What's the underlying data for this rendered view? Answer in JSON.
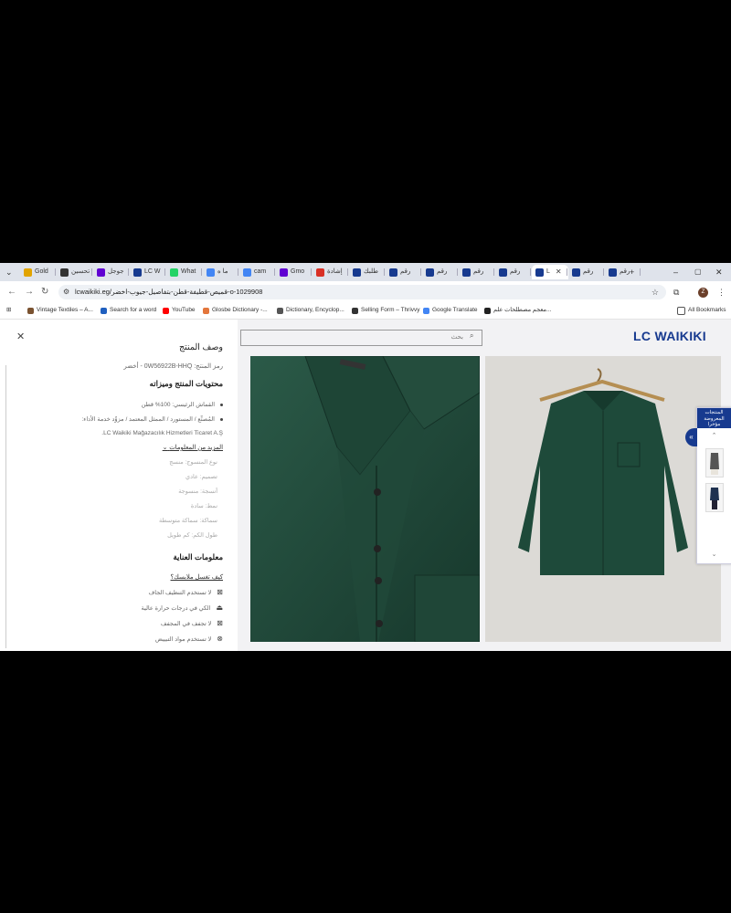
{
  "browser": {
    "tabs": [
      {
        "label": "Gold",
        "favicon": "gold-coin-icon",
        "color": "#e2a400"
      },
      {
        "label": "تحسين",
        "favicon": "circle-icon",
        "color": "#333333"
      },
      {
        "label": "جوجل",
        "favicon": "yahoo-icon",
        "color": "#6001d2"
      },
      {
        "label": "LC W",
        "favicon": "lcw-icon",
        "color": "#173a8f"
      },
      {
        "label": "What",
        "favicon": "whatsapp-icon",
        "color": "#25d366"
      },
      {
        "label": "ما ه",
        "favicon": "google-icon",
        "color": "#4285f4"
      },
      {
        "label": "cam",
        "favicon": "google-icon",
        "color": "#4285f4"
      },
      {
        "label": "Gmo",
        "favicon": "yahoo-icon",
        "color": "#6001d2"
      },
      {
        "label": "إشادة",
        "favicon": "gmail-icon",
        "color": "#d93025"
      },
      {
        "label": "طلبك",
        "favicon": "lcw-icon",
        "color": "#173a8f"
      },
      {
        "label": "رقم",
        "favicon": "lcw-icon",
        "color": "#173a8f"
      },
      {
        "label": "رقم",
        "favicon": "lcw-icon",
        "color": "#173a8f"
      },
      {
        "label": "رقم",
        "favicon": "lcw-icon",
        "color": "#173a8f"
      },
      {
        "label": "رقم",
        "favicon": "lcw-icon",
        "color": "#173a8f"
      },
      {
        "label": "L",
        "favicon": "lcw-icon",
        "color": "#173a8f"
      },
      {
        "label": "رقم",
        "favicon": "lcw-icon",
        "color": "#173a8f"
      },
      {
        "label": "رقم",
        "favicon": "lcw-icon",
        "color": "#173a8f"
      }
    ],
    "tab_close": "✕",
    "new_tab": "+",
    "win_min": "–",
    "win_max": "▢",
    "win_close": "✕",
    "url": "lcwaikiki.eg/قميص-قطيفة-قطن-بتفاصيل-جيوب-اخضر-o-1029908",
    "avatar_letter": "Z",
    "bookmarks": [
      {
        "label": "Vintage Textiles – A...",
        "color": "#7a5230"
      },
      {
        "label": "Search for a word",
        "color": "#1f5fbf"
      },
      {
        "label": "YouTube",
        "color": "#ff0000"
      },
      {
        "label": "Glosbe Dictionary -...",
        "color": "#e3763c"
      },
      {
        "label": "Dictionary, Encyclop...",
        "color": "#555555"
      },
      {
        "label": "Selling Form – Thrivvy",
        "color": "#333333"
      },
      {
        "label": "Google Translate",
        "color": "#4285f4"
      },
      {
        "label": "معجم مصطلحات علم...",
        "color": "#222222"
      }
    ],
    "all_bookmarks": "All Bookmarks"
  },
  "panel": {
    "title": "وصف المنتج",
    "code": "رمز المنتج: 0W56922B-HHQ - أخضر",
    "contents_heading": "محتويات المنتج وميزاته",
    "bullets": [
      "القماش الرئيسي: 100% قطن",
      "المُصنِّع / المستورد / الممثل المعتمد / مزوِّد خدمة الأداء:",
      "LC Waikiki Mağazacılık Hizmetleri Ticaret A.Ş."
    ],
    "more_link": "المزيد من المعلومات",
    "details": [
      "نوع المنسوج: منسج",
      "تصميم: عادي",
      "أنسجة: منسوجة",
      "نمط: سادة",
      "سماكة: سماكة متوسطة",
      "طول الكم: كم طويل"
    ],
    "care_heading": "معلومات العناية",
    "care_link": "كيف تغسل ملابسك؟",
    "care": [
      {
        "text": "لا تستخدم التنظيف الجاف",
        "icon": "no-dry-clean-icon"
      },
      {
        "text": "الكي في درجات حرارة عالية",
        "icon": "iron-icon"
      },
      {
        "text": "لا تجفف في المجفف",
        "icon": "no-tumble-dry-icon"
      },
      {
        "text": "لا تستخدم مواد التبييض",
        "icon": "no-bleach-icon"
      }
    ],
    "close": "✕"
  },
  "content": {
    "search_placeholder": "بحث",
    "logo": "LC WAIKIKI",
    "image1_alt": "green-shirt-collar-closeup",
    "image2_alt": "green-shirt-on-hanger"
  },
  "widget": {
    "header": "المنتجات المعروضة مؤخرا",
    "expand": "«"
  },
  "colors": {
    "brand": "#173a8f",
    "shirt": "#1e4a3a"
  }
}
